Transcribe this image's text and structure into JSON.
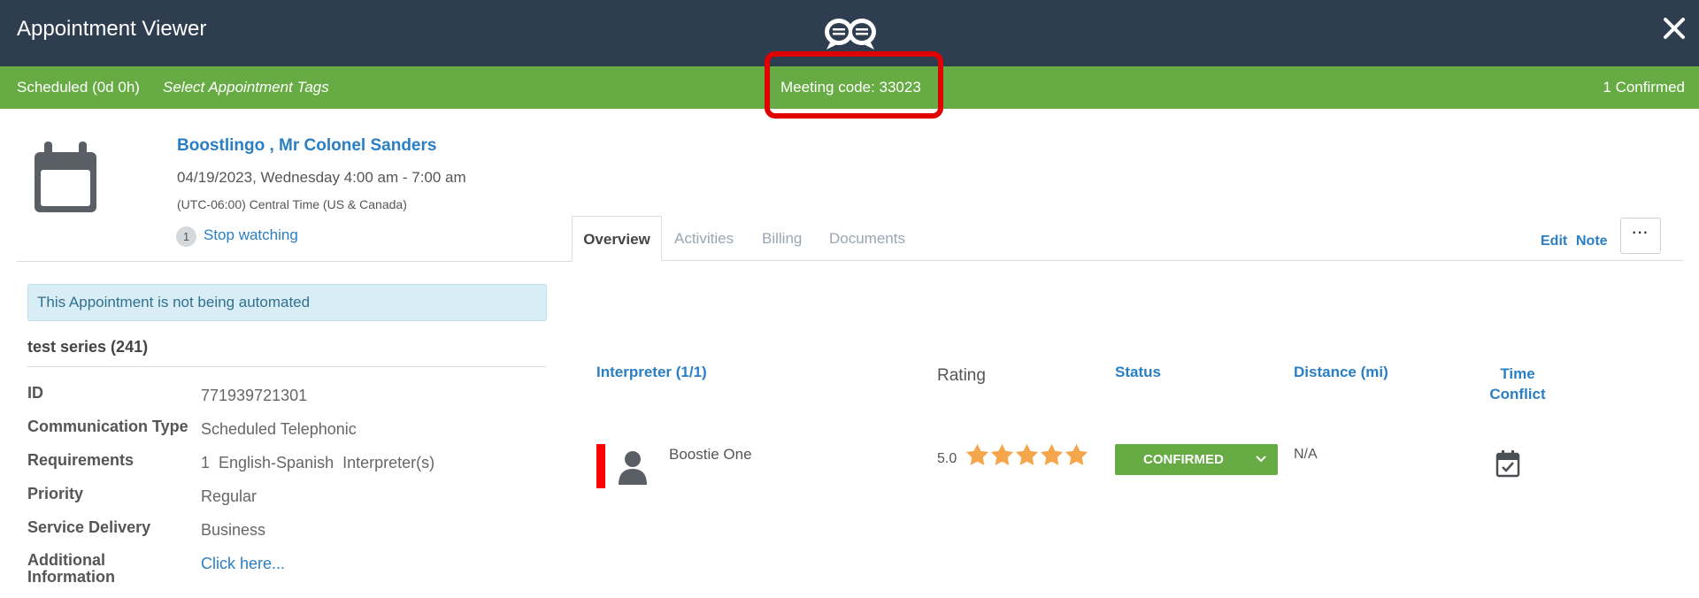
{
  "header": {
    "title": "Appointment Viewer",
    "logo_icon": "chat-bubbles-logo-icon",
    "close_icon": "close-icon"
  },
  "status_bar": {
    "status": "Scheduled (0d 0h)",
    "tags_link": "Select Appointment Tags",
    "meeting_code": "Meeting code: 33023",
    "confirmed_count": "1 Confirmed",
    "color": "#67ab44"
  },
  "appointment": {
    "client_name": "Boostlingo , Mr Colonel Sanders",
    "date_time": "04/19/2023, Wednesday 4:00 am - 7:00 am",
    "timezone": "(UTC-06:00) Central Time (US & Canada)",
    "watch_count": "1",
    "watch_link": "Stop watching"
  },
  "tabs": [
    {
      "label": "Overview",
      "active": true
    },
    {
      "label": "Activities",
      "active": false
    },
    {
      "label": "Billing",
      "active": false
    },
    {
      "label": "Documents",
      "active": false
    }
  ],
  "actions": {
    "edit": "Edit",
    "note": "Note",
    "more": "···"
  },
  "left_panel": {
    "alert": "This Appointment is not being automated",
    "series": "test series (241)",
    "details": [
      {
        "label": "ID",
        "value": "771939721301"
      },
      {
        "label": "Communication Type",
        "value": "Scheduled Telephonic"
      },
      {
        "label": "Requirements",
        "value": "1  English-Spanish  Interpreter(s)"
      },
      {
        "label": "Priority",
        "value": "Regular"
      },
      {
        "label": "Service Delivery",
        "value": "Business"
      },
      {
        "label": "Additional Information",
        "value": "Click here..."
      }
    ]
  },
  "interpreters": {
    "columns": {
      "interpreter": "Interpreter (1/1)",
      "rating": "Rating",
      "status": "Status",
      "distance": "Distance (mi)",
      "time_conflict": "Time Conflict"
    },
    "rows": [
      {
        "name": "Boostie One",
        "rating": "5.0",
        "stars": 5,
        "status": "CONFIRMED",
        "distance": "N/A"
      }
    ]
  }
}
